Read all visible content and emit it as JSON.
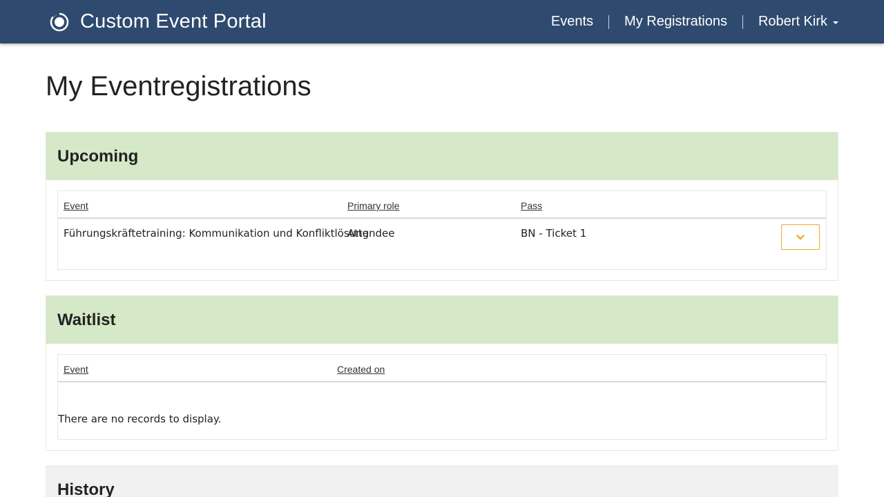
{
  "app": {
    "title": "Custom Event Portal"
  },
  "nav": {
    "events": "Events",
    "my_registrations": "My Registrations",
    "user": "Robert Kirk"
  },
  "page": {
    "title": "My Eventregistrations"
  },
  "upcoming": {
    "title": "Upcoming",
    "columns": {
      "event": "Event",
      "primary_role": "Primary role",
      "pass": "Pass"
    },
    "rows": [
      {
        "event": "Führungskräftetraining: Kommunikation und Konfliktlösung",
        "primary_role": "Attendee",
        "pass": "BN - Ticket 1"
      }
    ]
  },
  "waitlist": {
    "title": "Waitlist",
    "columns": {
      "event": "Event",
      "created_on": "Created on"
    },
    "empty_message": "There are no records to display."
  },
  "history": {
    "title": "History"
  },
  "colors": {
    "navbar": "#2f4a6f",
    "panel_heading": "#d5e8c8",
    "accent": "#f0a830"
  }
}
